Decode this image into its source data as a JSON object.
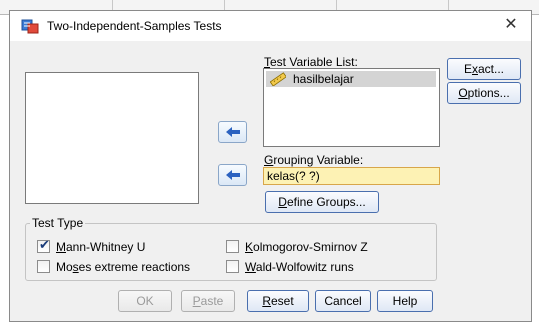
{
  "dialog": {
    "title": "Two-Independent-Samples Tests",
    "close_label": "✕"
  },
  "test_variable": {
    "label_pre": "",
    "label_u": "T",
    "label_post": "est Variable List:",
    "items": [
      "hasilbelajar"
    ]
  },
  "grouping": {
    "label_u": "G",
    "label_post": "rouping Variable:",
    "value": "kelas(? ?)",
    "define_pre": "",
    "define_u": "D",
    "define_post": "efine Groups..."
  },
  "side_buttons": {
    "exact_pre": "E",
    "exact_u": "x",
    "exact_post": "act...",
    "options_u": "O",
    "options_post": "ptions..."
  },
  "test_type": {
    "title": "Test Type",
    "mann_u": "M",
    "mann_post": "ann-Whitney U",
    "mann_checked": true,
    "ks_u": "K",
    "ks_post": "olmogorov-Smirnov Z",
    "ks_checked": false,
    "moses_pre": "Mo",
    "moses_u": "s",
    "moses_post": "es extreme reactions",
    "moses_checked": false,
    "wald_u": "W",
    "wald_post": "ald-Wolfowitz runs",
    "wald_checked": false
  },
  "footer": {
    "ok": "OK",
    "paste_u": "P",
    "paste_post": "aste",
    "reset_u": "R",
    "reset_post": "eset",
    "cancel": "Cancel",
    "help": "Help"
  },
  "colors": {
    "dialog_bg": "#f0f0f0",
    "grouping_bg": "#fdf2b4",
    "arrow_blue": "#2b62c0"
  }
}
